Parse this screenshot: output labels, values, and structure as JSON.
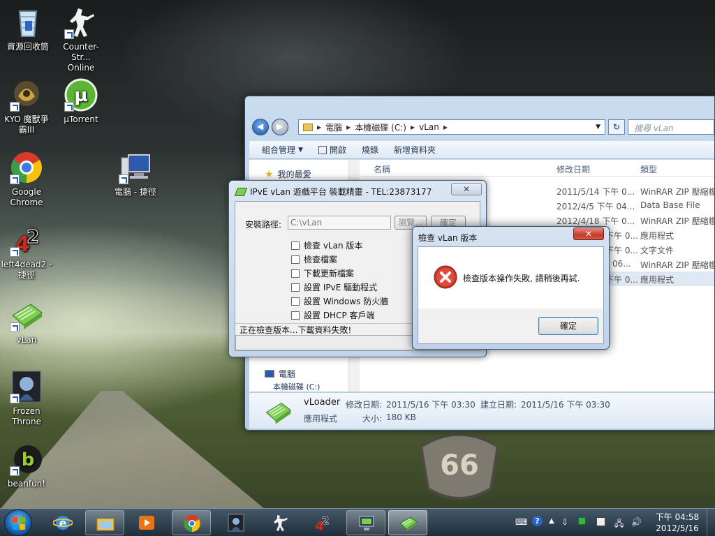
{
  "desktop": {
    "icons": [
      {
        "label": "資源回收筒",
        "icon": "recycle-bin-icon"
      },
      {
        "label": "Counter-Strike Online",
        "line1": "Counter-Str...",
        "line2": "Online",
        "icon": "counter-strike-icon"
      },
      {
        "label": "KYO 魔獸爭霸III",
        "line1": "KYO 魔獸爭",
        "line2": "霸III",
        "icon": "warcraft-icon"
      },
      {
        "label": "µTorrent",
        "icon": "utorrent-icon"
      },
      {
        "label": "Google Chrome",
        "line1": "Google",
        "line2": "Chrome",
        "icon": "chrome-icon"
      },
      {
        "label": "電腦 - 捷徑",
        "icon": "computer-icon"
      },
      {
        "label": "left4dead2 - 捷徑",
        "line1": "left4dead2 -",
        "line2": "捷徑",
        "icon": "left4dead2-icon"
      },
      {
        "label": "vLan",
        "icon": "vlan-icon"
      },
      {
        "label": "Frozen Throne",
        "line1": "Frozen",
        "line2": "Throne",
        "icon": "frozen-throne-icon"
      },
      {
        "label": "beanfun!",
        "icon": "beanfun-icon"
      }
    ]
  },
  "explorer": {
    "breadcrumb": [
      "電腦",
      "本機磁碟 (C:)",
      "vLan"
    ],
    "search_placeholder": "搜尋 vLan",
    "toolbar": {
      "organize": "組合管理",
      "open": "開啟",
      "burn": "燒錄",
      "new_folder": "新增資料夾"
    },
    "nav": {
      "favorites": "我的最愛",
      "computer": "電腦",
      "local_disk": "本機磁碟 (C:)"
    },
    "columns": {
      "name": "名稱",
      "date": "修改日期",
      "type": "類型"
    },
    "rows": [
      {
        "date": "2011/5/14 下午 0...",
        "type": "WinRAR ZIP 壓縮檔"
      },
      {
        "date": "2012/4/5 下午 04...",
        "type": "Data Base File"
      },
      {
        "date": "2012/4/18 下午 0...",
        "type": "WinRAR ZIP 壓縮檔"
      },
      {
        "date": "下午 0...",
        "type": "應用程式"
      },
      {
        "date": "下午 0...",
        "type": "文字文件"
      },
      {
        "date": "06...",
        "type": "WinRAR ZIP 壓縮檔"
      },
      {
        "date": "下午 0...",
        "type": "應用程式"
      }
    ],
    "details": {
      "name": "vLoader",
      "type": "應用程式",
      "modified_label": "修改日期:",
      "modified": "2011/5/16 下午 03:30",
      "created_label": "建立日期:",
      "created": "2011/5/16 下午 03:30",
      "size_label": "大小:",
      "size": "180 KB"
    }
  },
  "vlan_dialog": {
    "title": "IPvE vLan 遊戲平台 裝載精靈 - TEL:23873177",
    "close": "✕",
    "install_label": "安裝路徑:",
    "install_path": "C:\\vLan",
    "browse": "瀏覽...",
    "confirm": "確定",
    "checks": [
      "檢查 vLan 版本",
      "檢查檔案",
      "下載更新檔案",
      "設置 IPvE 驅動程式",
      "設置 Windows 防火牆",
      "設置 DHCP 客戶端"
    ],
    "status": "正在檢查版本...下載資料失敗!"
  },
  "error_box": {
    "title": "檢查 vLan 版本",
    "message": "檢查版本操作失敗, 請稍後再試.",
    "ok": "確定",
    "close": "✕"
  },
  "taskbar": {
    "items": [
      "ie-icon",
      "explorer-folder-icon",
      "media-player-icon",
      "chrome-icon",
      "frozen-throne-icon",
      "counter-strike-icon",
      "left4dead2-icon",
      "remote-desktop-icon",
      "vlan-icon"
    ],
    "time": "下午 04:58",
    "date": "2012/5/16"
  },
  "colors": {
    "accent": "#1e5aa8",
    "error_red": "#c4382a"
  }
}
